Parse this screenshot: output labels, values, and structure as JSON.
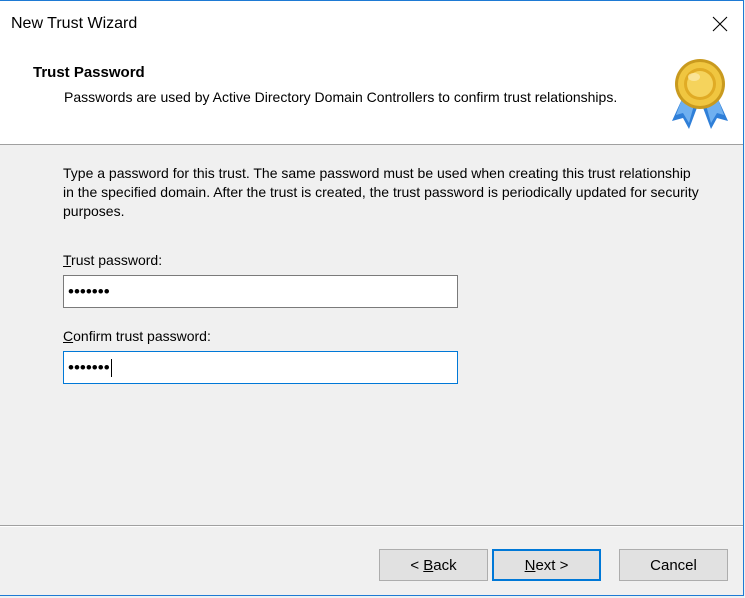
{
  "window": {
    "title": "New Trust Wizard"
  },
  "header": {
    "title": "Trust Password",
    "description": "Passwords are used by Active Directory Domain Controllers to confirm trust relationships.",
    "icon": "certificate-ribbon-icon"
  },
  "instructions": "Type a password for this trust. The same password must be used when creating this trust relationship in the specified domain. After the trust is created, the trust password is periodically updated for security purposes.",
  "fields": {
    "trust_password": {
      "label_mnemonic": "T",
      "label_rest": "rust password:",
      "value": "•••••••"
    },
    "confirm_password": {
      "label_mnemonic": "C",
      "label_rest": "onfirm trust password:",
      "value": "•••••••"
    }
  },
  "buttons": {
    "back_prefix": "< ",
    "back_mnemonic": "B",
    "back_rest": "ack",
    "next_mnemonic": "N",
    "next_rest": "ext >",
    "cancel": "Cancel"
  },
  "colors": {
    "accent": "#0078d7",
    "window_border": "#1e7ad4",
    "button_face": "#e1e1e1"
  }
}
